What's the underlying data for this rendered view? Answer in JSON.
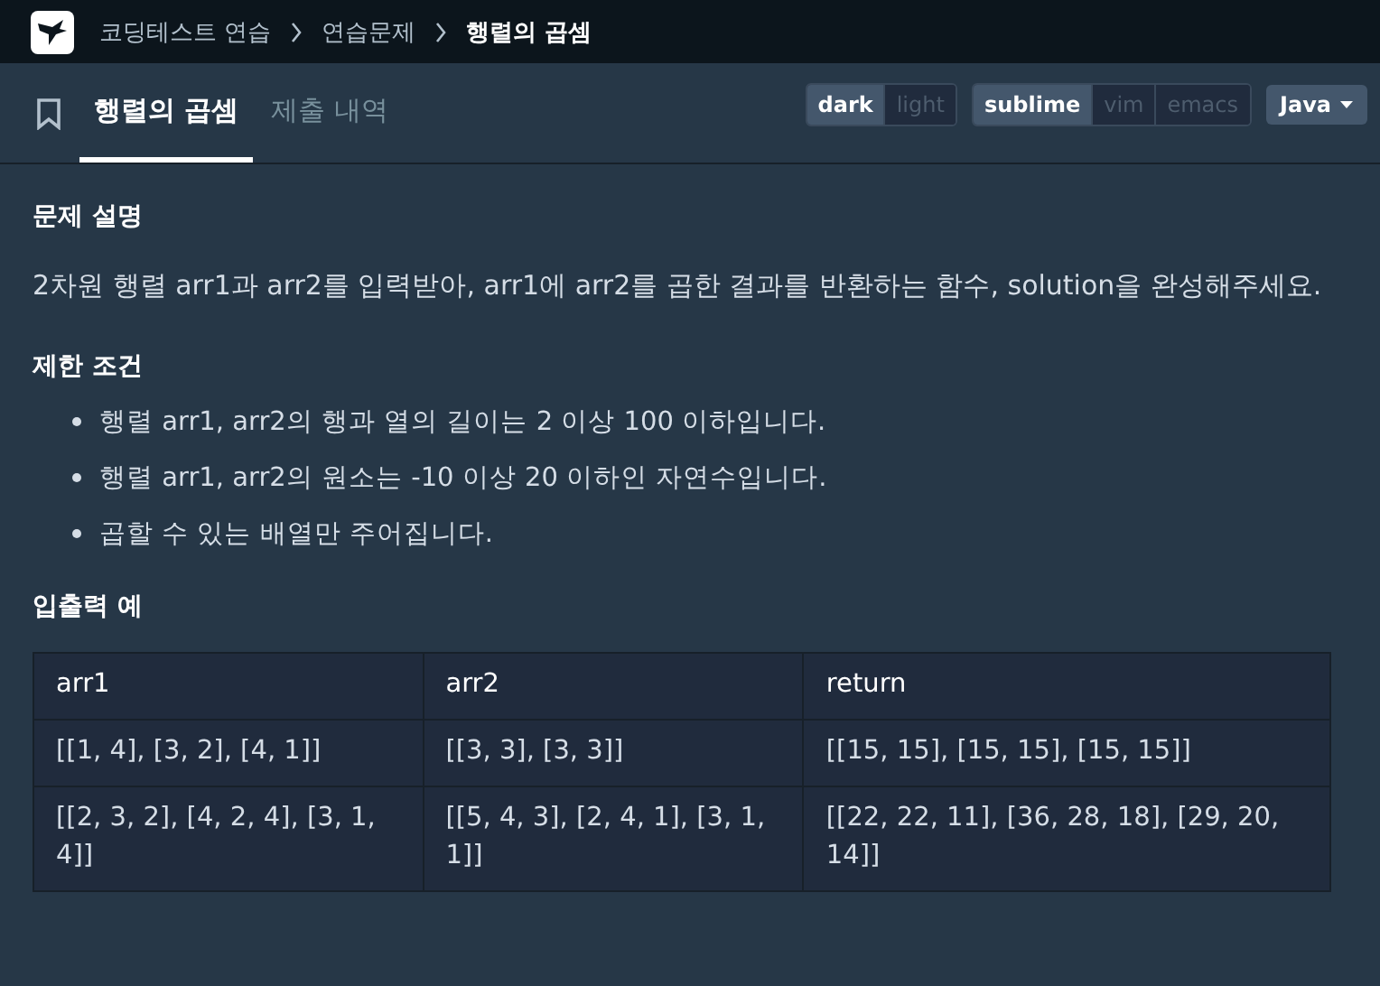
{
  "breadcrumb": [
    {
      "label": "코딩테스트 연습",
      "current": false
    },
    {
      "label": "연습문제",
      "current": false
    },
    {
      "label": "행렬의 곱셈",
      "current": true
    }
  ],
  "tabs": [
    {
      "label": "행렬의 곱셈",
      "selected": true
    },
    {
      "label": "제출 내역",
      "selected": false
    }
  ],
  "theme_toggle": [
    {
      "label": "dark",
      "selected": true
    },
    {
      "label": "light",
      "selected": false
    }
  ],
  "keymap_toggle": [
    {
      "label": "sublime",
      "selected": true
    },
    {
      "label": "vim",
      "selected": false
    },
    {
      "label": "emacs",
      "selected": false
    }
  ],
  "language": "Java",
  "sections": [
    {
      "kind": "paragraph",
      "title": "문제 설명",
      "text": "2차원 행렬 arr1과 arr2를 입력받아, arr1에 arr2를 곱한 결과를 반환하는 함수, solution을 완성해주세요."
    },
    {
      "kind": "list",
      "title": "제한 조건",
      "items": [
        "행렬 arr1, arr2의 행과 열의 길이는 2 이상 100 이하입니다.",
        "행렬 arr1, arr2의 원소는 -10 이상 20 이하인 자연수입니다.",
        "곱할 수 있는 배열만 주어집니다."
      ]
    },
    {
      "kind": "table",
      "title": "입출력 예",
      "columns": [
        "arr1",
        "arr2",
        "return"
      ],
      "rows": [
        [
          "[[1, 4], [3, 2], [4, 1]]",
          "[[3, 3], [3, 3]]",
          "[[15, 15], [15, 15], [15, 15]]"
        ],
        [
          "[[2, 3, 2], [4, 2, 4], [3, 1, 4]]",
          "[[5, 4, 3], [2, 4, 1], [3, 1, 1]]",
          "[[22, 22, 11], [36, 28, 18], [29, 20, 14]]"
        ]
      ]
    }
  ]
}
